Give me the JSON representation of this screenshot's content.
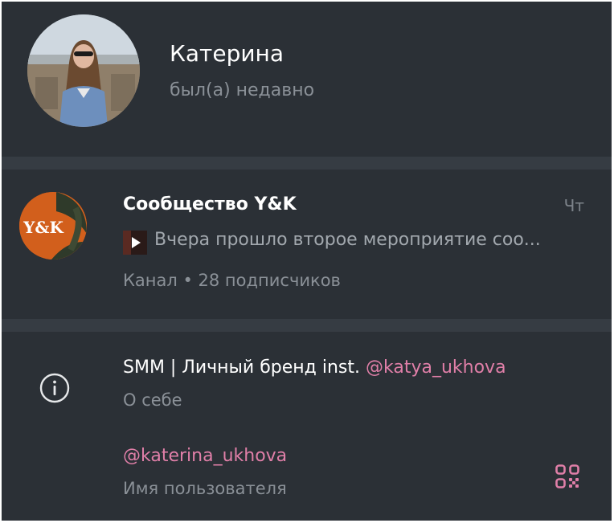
{
  "profile": {
    "name": "Катерина",
    "status": "был(а) недавно"
  },
  "channel": {
    "name": "Сообщество Y&K",
    "logo_text": "Y&K",
    "day": "Чт",
    "preview": "Вчера прошло второе мероприятие соо...",
    "meta": "Канал • 28 подписчиков"
  },
  "info": {
    "bio_text": "SMM | Личный бренд inst. ",
    "bio_link": "@katya_ukhova",
    "bio_caption": "О себе",
    "username": "@katerina_ukhova",
    "username_caption": "Имя пользователя"
  },
  "colors": {
    "background": "#2b3036",
    "divider": "#363c43",
    "accent_link": "#e07fa8",
    "secondary_text": "#8a9097"
  },
  "icons": {
    "info": "info-circle-icon",
    "qr": "qr-code-icon"
  }
}
